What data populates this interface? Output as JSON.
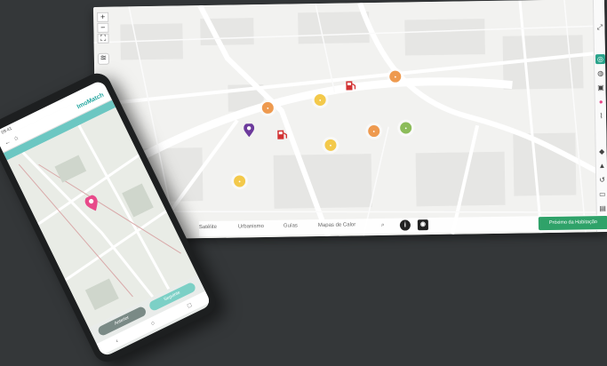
{
  "desktop": {
    "map_controls": [
      "+",
      "−",
      "⛶"
    ],
    "layers_icon": "layers-icon",
    "tabs": [
      "Satélite",
      "Urbanismo",
      "Guías",
      "Mapas de Calor"
    ],
    "search_icon": "search-icon",
    "info_icon": "info-icon",
    "camera_icon": "camera-icon",
    "proximity_button": "Próximo da Habitação",
    "right_toolbar": [
      "expand-icon",
      "target-icon",
      "globe-icon",
      "trash-icon",
      "pin-icon",
      "chart-icon",
      "bell-icon",
      "warning-icon",
      "history-icon",
      "save-icon",
      "print-icon"
    ],
    "accent": "#2aa38b",
    "green_button": "#2fa269"
  },
  "phone": {
    "status_time": "09:41",
    "logo": "ImoMatch",
    "buttons": [
      "Anterior",
      "Seguinte"
    ],
    "nav": [
      "‹",
      "○",
      "□"
    ],
    "pin_color": "#e84a8a",
    "header_color": "#6cc7c2"
  }
}
